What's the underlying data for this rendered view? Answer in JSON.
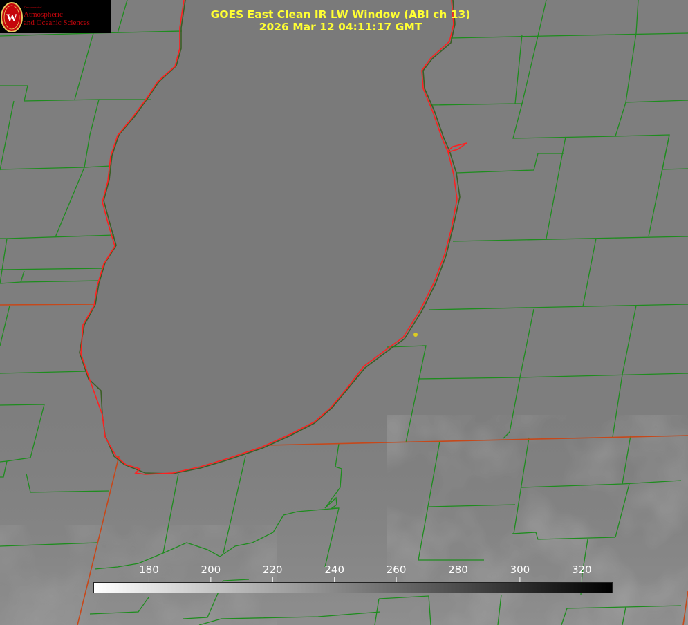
{
  "header": {
    "title_line1": "GOES East Clean IR LW Window (ABI ch 13)",
    "title_line2": "2026 Mar 12 04:11:17 GMT"
  },
  "logo": {
    "department": "Department of",
    "name_line1": "Atmospheric",
    "name_line2": "and Oceanic Sciences"
  },
  "colorbar": {
    "min": 162,
    "max": 330,
    "ticks": [
      "180",
      "200",
      "220",
      "240",
      "260",
      "280",
      "300",
      "320"
    ],
    "start_color": "#ffffff",
    "end_color": "#000000"
  },
  "colors": {
    "title": "#ffff33",
    "county_lines": "#1e8c1e",
    "state_lines": "#d83a1a",
    "coastline": "#ff2020",
    "point_marker": "#ddcc22",
    "lake": "#7a7a7a",
    "land": "#808080"
  }
}
